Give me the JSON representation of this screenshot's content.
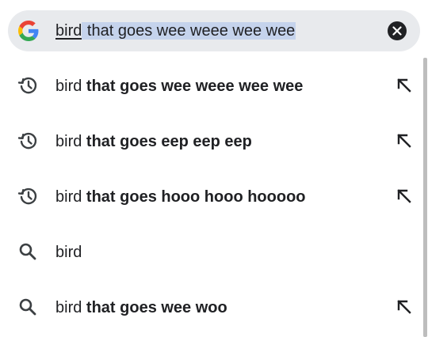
{
  "search": {
    "typed": "bird",
    "completion": " that goes wee weee wee wee",
    "clear_icon": "close-circle-icon",
    "logo_icon": "google-g-icon"
  },
  "suggestions": [
    {
      "icon": "history-icon",
      "prefix": "bird",
      "suffix": " that goes wee weee wee wee",
      "has_arrow": true
    },
    {
      "icon": "history-icon",
      "prefix": "bird",
      "suffix": " that goes eep eep eep",
      "has_arrow": true
    },
    {
      "icon": "history-icon",
      "prefix": "bird",
      "suffix": " that goes hooo hooo hooooo",
      "has_arrow": true
    },
    {
      "icon": "search-icon",
      "prefix": "bird",
      "suffix": "",
      "has_arrow": false
    },
    {
      "icon": "search-icon",
      "prefix": "bird",
      "suffix": " that goes wee woo",
      "has_arrow": true
    }
  ],
  "colors": {
    "bar_bg": "#e8eaed",
    "selection": "#c5d3ec",
    "icon": "#3c4043",
    "text": "#202124"
  }
}
